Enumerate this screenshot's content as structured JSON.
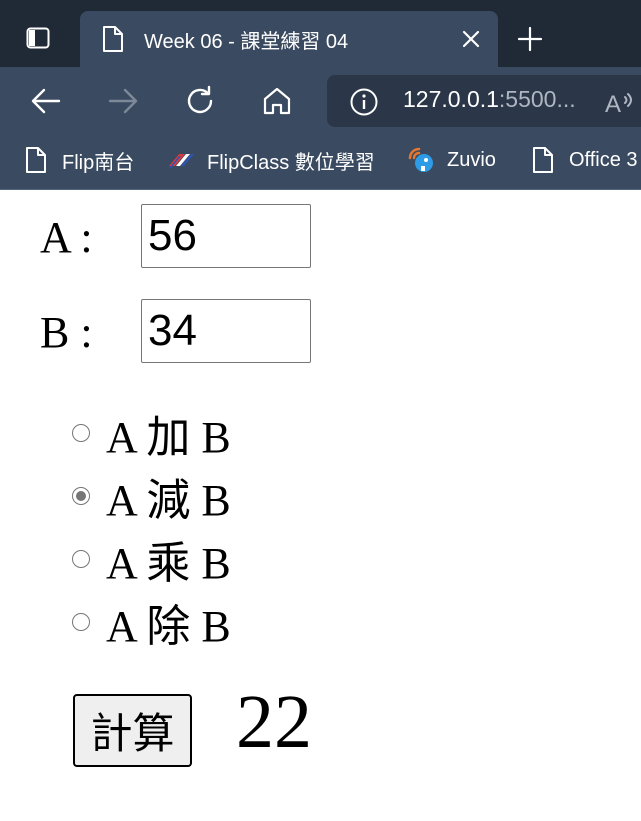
{
  "browser": {
    "tab": {
      "title": "Week 06 - 課堂練習 04",
      "icon": "page-icon"
    },
    "address_bar": {
      "host": "127.0.0.1",
      "port_suffix": ":5500..."
    },
    "bookmarks": [
      {
        "label": "Flip南台",
        "icon": "page-icon"
      },
      {
        "label": "FlipClass 數位學習",
        "icon": "flipclass-icon"
      },
      {
        "label": "Zuvio",
        "icon": "zuvio-icon"
      },
      {
        "label": "Office 3",
        "icon": "page-icon"
      }
    ],
    "colors": {
      "tabbar": "#202a37",
      "toolbar": "#3a4a60",
      "address": "#2b3748"
    }
  },
  "page": {
    "field_a": {
      "label": "A :",
      "value": "56"
    },
    "field_b": {
      "label": "B :",
      "value": "34"
    },
    "operations": [
      {
        "label": "A 加 B",
        "checked": false
      },
      {
        "label": "A 減 B",
        "checked": true
      },
      {
        "label": "A 乘 B",
        "checked": false
      },
      {
        "label": "A 除 B",
        "checked": false
      }
    ],
    "calculate_button": "計算",
    "result": "22"
  }
}
